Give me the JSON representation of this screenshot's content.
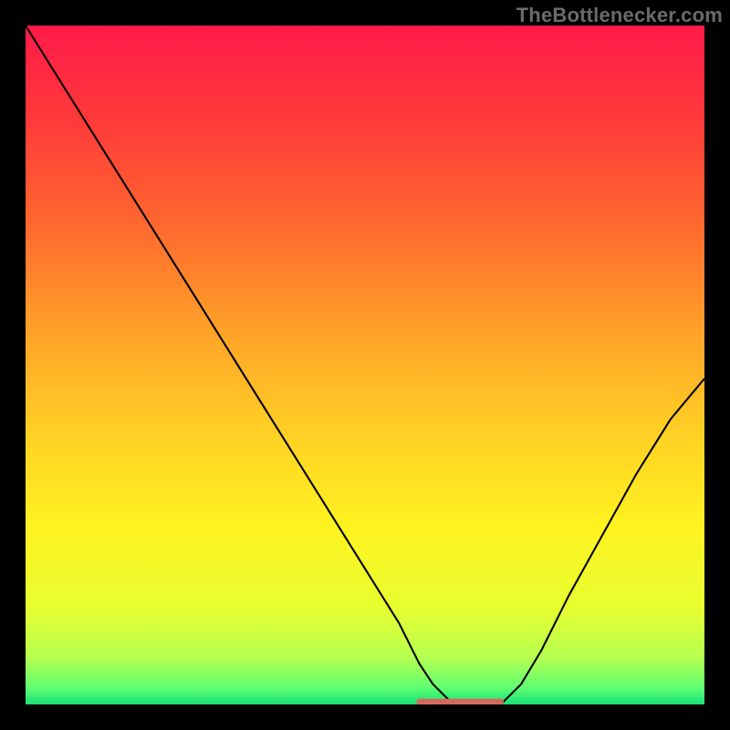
{
  "watermark": "TheBottlenecker.com",
  "chart_data": {
    "type": "line",
    "title": "",
    "xlabel": "",
    "ylabel": "",
    "xlim": [
      0,
      100
    ],
    "ylim": [
      0,
      100
    ],
    "x": [
      0,
      5,
      10,
      15,
      20,
      25,
      30,
      35,
      40,
      45,
      50,
      55,
      58,
      60,
      63,
      66,
      68,
      70,
      73,
      76,
      80,
      85,
      90,
      95,
      100
    ],
    "values": [
      100,
      92,
      84,
      76,
      68,
      60,
      52,
      44,
      36,
      28,
      20,
      12,
      6,
      3,
      0,
      0,
      0,
      0,
      3,
      8,
      16,
      25,
      34,
      42,
      48
    ],
    "gradient_stops": [
      {
        "pos": 0.0,
        "color": "#ff1a49"
      },
      {
        "pos": 0.14,
        "color": "#ff3a3a"
      },
      {
        "pos": 0.3,
        "color": "#ff6a2e"
      },
      {
        "pos": 0.45,
        "color": "#ffa228"
      },
      {
        "pos": 0.6,
        "color": "#ffd024"
      },
      {
        "pos": 0.74,
        "color": "#fff320"
      },
      {
        "pos": 0.86,
        "color": "#e6ff30"
      },
      {
        "pos": 0.93,
        "color": "#b6ff50"
      },
      {
        "pos": 0.975,
        "color": "#60ff70"
      },
      {
        "pos": 1.0,
        "color": "#18e07a"
      }
    ],
    "marker": {
      "color": "#d46a5e",
      "x_start": 58,
      "x_end": 70,
      "y": 0.4,
      "thickness": 2.5
    }
  }
}
